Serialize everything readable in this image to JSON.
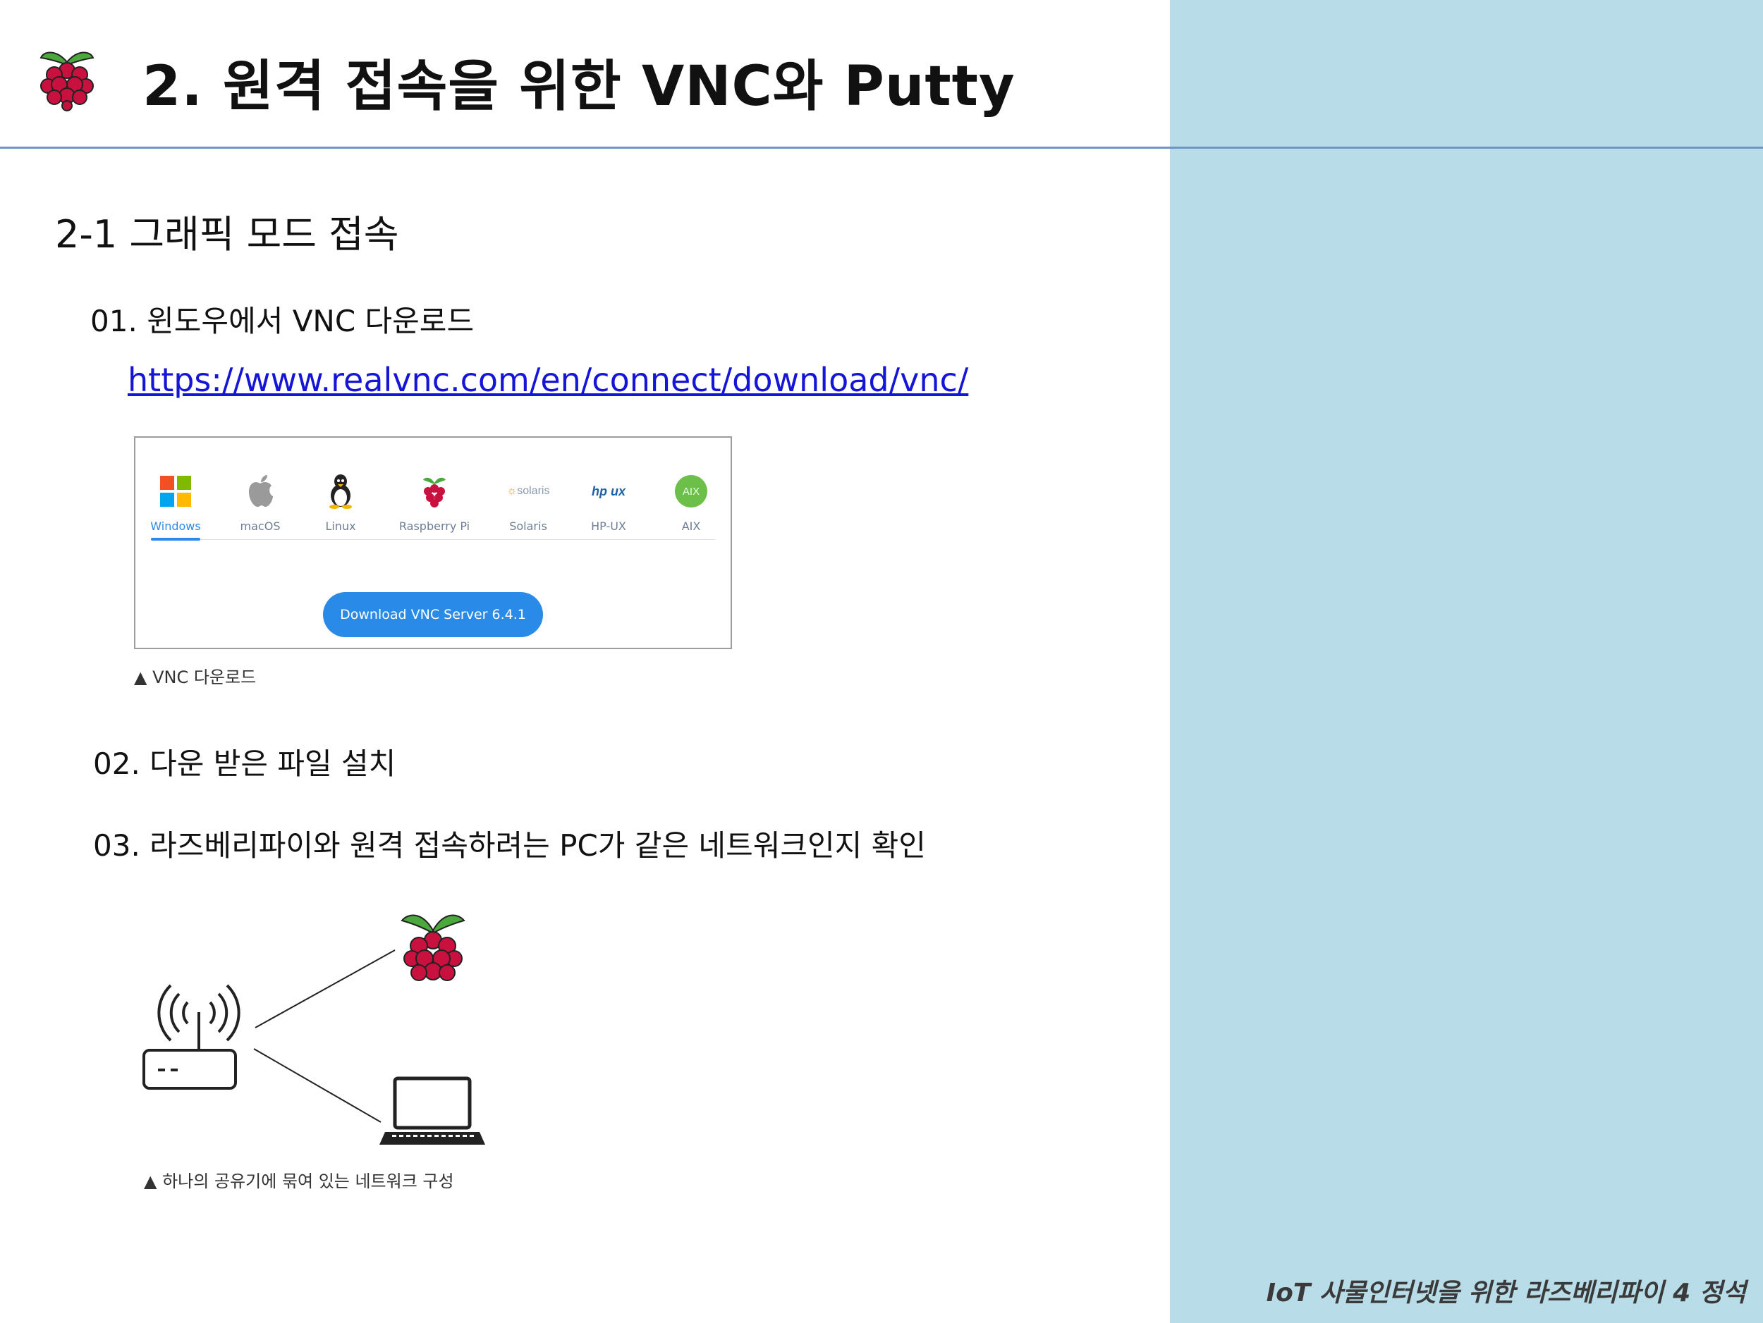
{
  "header": {
    "title": "2. 원격 접속을 위한 VNC와 Putty",
    "logo_icon": "raspberry-pi-logo-icon"
  },
  "section": {
    "heading": "2-1 그래픽 모드 접속"
  },
  "steps": [
    {
      "label": "01. 윈도우에서 VNC 다운로드"
    },
    {
      "label": "02. 다운 받은 파일 설치"
    },
    {
      "label": "03. 라즈베리파이와 원격 접속하려는 PC가 같은 네트워크인지 확인"
    }
  ],
  "link": {
    "url": "https://www.realvnc.com/en/connect/download/vnc/"
  },
  "download_panel": {
    "platforms": [
      {
        "label": "Windows",
        "icon": "windows-icon",
        "selected": true
      },
      {
        "label": "macOS",
        "icon": "apple-icon"
      },
      {
        "label": "Linux",
        "icon": "linux-tux-icon"
      },
      {
        "label": "Raspberry Pi",
        "icon": "raspberry-pi-icon"
      },
      {
        "label": "Solaris",
        "icon": "solaris-icon",
        "logo_text": "solaris"
      },
      {
        "label": "HP-UX",
        "icon": "hp-ux-icon",
        "logo_text": "hp ux"
      },
      {
        "label": "AIX",
        "icon": "aix-icon",
        "logo_text": "AIX"
      }
    ],
    "button_label": "Download VNC Server 6.4.1",
    "accent_color": "#2a8ae8"
  },
  "captions": {
    "download": "▲ VNC 다운로드",
    "network": "▲ 하나의 공유기에 묶여 있는 네트워크 구성"
  },
  "diagram": {
    "nodes": [
      "router-icon",
      "raspberry-pi-icon",
      "laptop-icon"
    ]
  },
  "footer": {
    "text": "IoT 사물인터넷을 위한 라즈베리파이 4 정석"
  },
  "colors": {
    "side_panel": "#b8dde8",
    "header_rule": "#6d95c9",
    "link": "#1515d8"
  }
}
